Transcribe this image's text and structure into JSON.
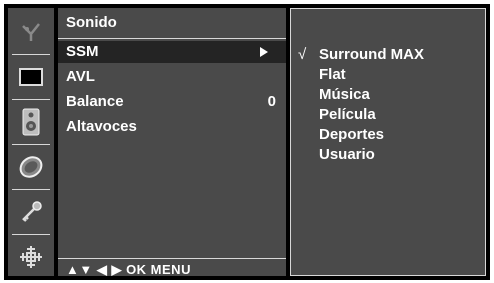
{
  "menu": {
    "title": "Sonido",
    "items": [
      {
        "label": "SSM",
        "value": ""
      },
      {
        "label": "AVL",
        "value": ""
      },
      {
        "label": "Balance",
        "value": "0"
      },
      {
        "label": "Altavoces",
        "value": ""
      }
    ],
    "selected_index": 0,
    "hint": "▲▼ ◀ ▶ OK MENU"
  },
  "submenu": {
    "check_mark": "√",
    "options": [
      "Surround MAX",
      "Flat",
      "Música",
      "Película",
      "Deportes",
      "Usuario"
    ],
    "checked_index": 0
  },
  "sidebar": {
    "icons": [
      "picture-icon",
      "screen-icon",
      "speaker-icon",
      "clock-icon",
      "key-icon",
      "input-icon"
    ]
  },
  "colors": {
    "panel": "#4a4a4a",
    "highlight": "#242424",
    "frame": "#000000",
    "text": "#ffffff"
  }
}
